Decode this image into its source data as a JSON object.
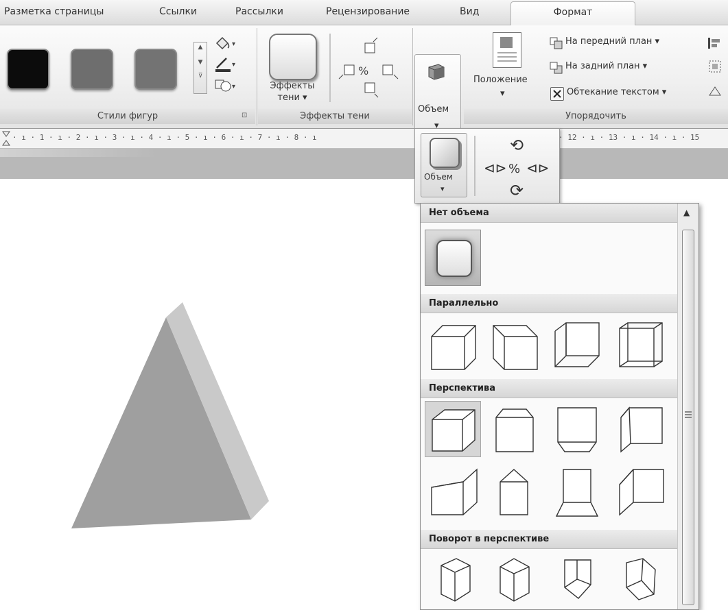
{
  "tabs": [
    "Разметка страницы",
    "Ссылки",
    "Рассылки",
    "Рецензирование",
    "Вид",
    "Формат"
  ],
  "active_tab": "Формат",
  "ribbon": {
    "groups": {
      "shape_styles": "Стили фигур",
      "shadow_effects": "Эффекты тени",
      "arrange": "Упорядочить"
    },
    "shadow_effects_button": [
      "Эффекты",
      "тени ▾"
    ],
    "volume_button": "Объем",
    "position_button": "Положение",
    "bring_front": "На передний план",
    "send_back": "На задний план",
    "text_wrap": "Обтекание текстом"
  },
  "ruler": {
    "left_ticks": "· ı · 1 · ı · 2 · ı · 3 · ı · 4 · ı · 5 · ı · 6 · ı · 7 · ı · 8 · ı",
    "right_ticks": "· 12 · ı · 13 · ı · 14 · ı · 15"
  },
  "popup": {
    "volume_label": "Объем"
  },
  "gallery": {
    "sections": [
      "Нет объема",
      "Параллельно",
      "Перспектива",
      "Поворот в перспективе"
    ]
  },
  "colors": {
    "swatch_1": "#0c0c0c",
    "swatch_2": "#6e6e6e",
    "swatch_3": "#737373",
    "triangle_front": "#9f9f9f",
    "triangle_side": "#c9c9c9"
  },
  "icons": [
    "paint-bucket-icon",
    "outline-pen-icon",
    "shape-change-icon",
    "shadow-nudge-icon",
    "rotate-icon",
    "tilt-icon",
    "cube-icon"
  ]
}
